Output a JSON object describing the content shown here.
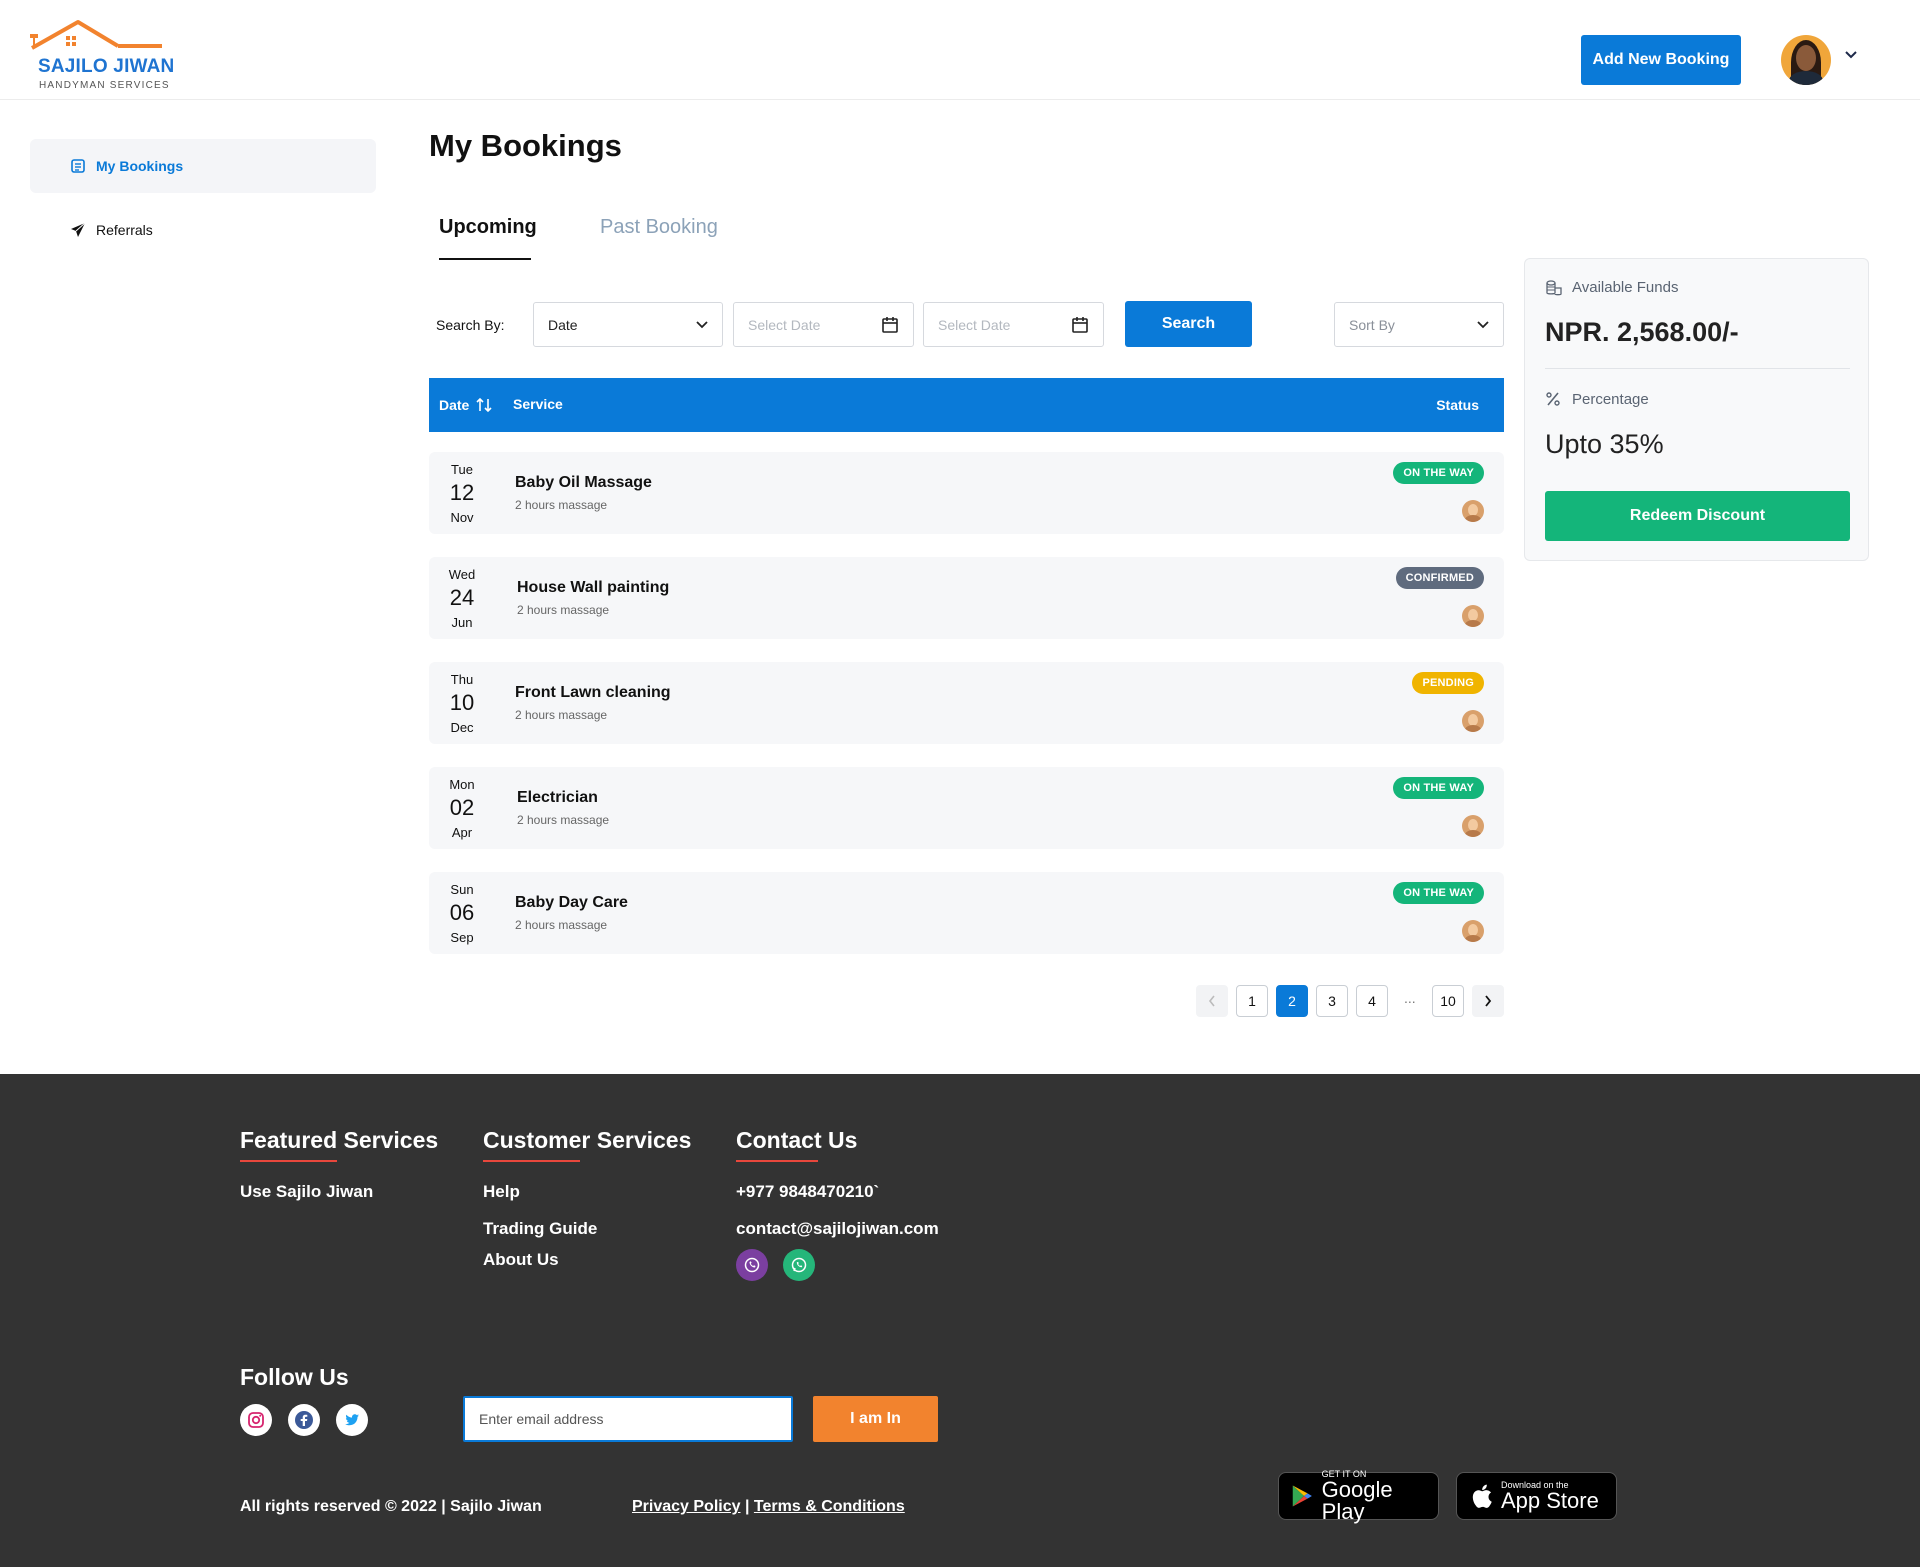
{
  "header": {
    "brand_name": "SAJILO JIWAN",
    "brand_tagline": "HANDYMAN SERVICES",
    "add_booking_label": "Add New Booking"
  },
  "sidebar": {
    "items": [
      {
        "label": "My Bookings",
        "icon": "bookings-icon",
        "active": true
      },
      {
        "label": "Referrals",
        "icon": "paper-plane-icon",
        "active": false
      }
    ]
  },
  "main": {
    "title": "My Bookings",
    "tabs": [
      {
        "label": "Upcoming",
        "active": true
      },
      {
        "label": "Past Booking",
        "active": false
      }
    ],
    "filters": {
      "search_by_label": "Search By:",
      "search_by_value": "Date",
      "date_from_placeholder": "Select Date",
      "date_to_placeholder": "Select Date",
      "search_button": "Search",
      "sort_placeholder": "Sort By"
    },
    "table": {
      "headers": {
        "date": "Date",
        "service": "Service",
        "status": "Status"
      },
      "rows": [
        {
          "day": "Tue",
          "date": "12",
          "month": "Nov",
          "service": "Baby Oil Massage",
          "detail": "2 hours massage",
          "status": "ON THE WAY"
        },
        {
          "day": "Wed",
          "date": "24",
          "month": "Jun",
          "service": "House Wall painting",
          "detail": "2 hours massage",
          "status": "CONFIRMED"
        },
        {
          "day": "Thu",
          "date": "10",
          "month": "Dec",
          "service": "Front Lawn cleaning",
          "detail": "2 hours massage",
          "status": "PENDING"
        },
        {
          "day": "Mon",
          "date": "02",
          "month": "Apr",
          "service": "Electrician",
          "detail": "2 hours massage",
          "status": "ON THE WAY"
        },
        {
          "day": "Sun",
          "date": "06",
          "month": "Sep",
          "service": "Baby Day Care",
          "detail": "2 hours massage",
          "status": "ON THE WAY"
        }
      ]
    },
    "pagination": {
      "pages": [
        "1",
        "2",
        "3",
        "4"
      ],
      "ellipsis": "...",
      "last_page": "10",
      "current_page": "2"
    }
  },
  "funds": {
    "available_label": "Available Funds",
    "available_amount": "NPR. 2,568.00/-",
    "percentage_label": "Percentage",
    "percentage_value": "Upto 35%",
    "redeem_button": "Redeem Discount"
  },
  "footer": {
    "featured": {
      "heading": "Featured Services",
      "links": [
        "Use Sajilo Jiwan"
      ]
    },
    "customer": {
      "heading": "Customer Services",
      "links": [
        "Help",
        "Trading Guide",
        "About Us"
      ]
    },
    "contact": {
      "heading": "Contact Us",
      "phone": "+977 9848470210`",
      "email": "contact@sajilojiwan.com"
    },
    "follow_heading": "Follow Us",
    "email_placeholder": "Enter email address",
    "subscribe_button": "I am In",
    "copyright": "All rights reserved © 2022 | Sajilo Jiwan",
    "privacy": "Privacy Policy",
    "separator": "|",
    "terms": "Terms & Conditions",
    "google_play": {
      "small": "GET IT ON",
      "big": "Google Play"
    },
    "app_store": {
      "small": "Download on the",
      "big": "App Store"
    }
  },
  "colors": {
    "primary": "#0a7ad8",
    "success": "#14b57a",
    "confirmed": "#5f6b7e",
    "pending": "#f0b400",
    "footer_bg": "#333333",
    "accent_orange": "#f2832e",
    "underline_red": "#e8473c"
  }
}
